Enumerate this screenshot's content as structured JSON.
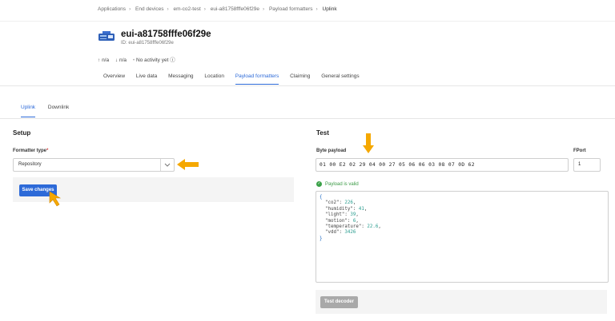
{
  "breadcrumbs": [
    "Applications",
    "End devices",
    "em-co2-test",
    "eui-a81758fffe06f29e",
    "Payload formatters",
    "Uplink"
  ],
  "device": {
    "title": "eui-a81758fffe06f29e",
    "id_line": "ID: eui-a81758fffe06f29e",
    "uplink_stat": "n/a",
    "downlink_stat": "n/a",
    "activity": "No activity yet"
  },
  "device_tabs": [
    "Overview",
    "Live data",
    "Messaging",
    "Location",
    "Payload formatters",
    "Claiming",
    "General settings"
  ],
  "active_device_tab": "Payload formatters",
  "sub_tabs": [
    "Uplink",
    "Downlink"
  ],
  "setup": {
    "heading": "Setup",
    "formatter_label": "Formatter type",
    "required_mark": "*",
    "formatter_value": "Repository",
    "save_label": "Save changes"
  },
  "test": {
    "heading": "Test",
    "byte_label": "Byte payload",
    "byte_value": "01 00 E2 02 29 04 00 27 05 06 06 03 08 07 0D 62",
    "fport_label": "FPort",
    "fport_value": "1",
    "valid_text": "Payload is valid",
    "decoded": [
      {
        "key": "\"co2\"",
        "value": "226"
      },
      {
        "key": "\"humidity\"",
        "value": "41"
      },
      {
        "key": "\"light\"",
        "value": "39"
      },
      {
        "key": "\"motion\"",
        "value": "6"
      },
      {
        "key": "\"temperature\"",
        "value": "22.6"
      },
      {
        "key": "\"vdd\"",
        "value": "3426"
      }
    ],
    "decoder_label": "Test decoder"
  },
  "colors": {
    "accent": "#2d6ad8",
    "annotation": "#f5a800",
    "valid": "#3aa148"
  }
}
